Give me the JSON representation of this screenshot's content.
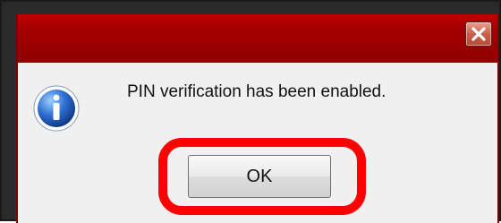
{
  "dialog": {
    "message": "PIN verification has been enabled.",
    "ok_label": "OK"
  },
  "icons": {
    "close": "close-icon",
    "info": "info-icon"
  },
  "colors": {
    "titlebar": "#a50000",
    "highlight": "#ff0000"
  }
}
